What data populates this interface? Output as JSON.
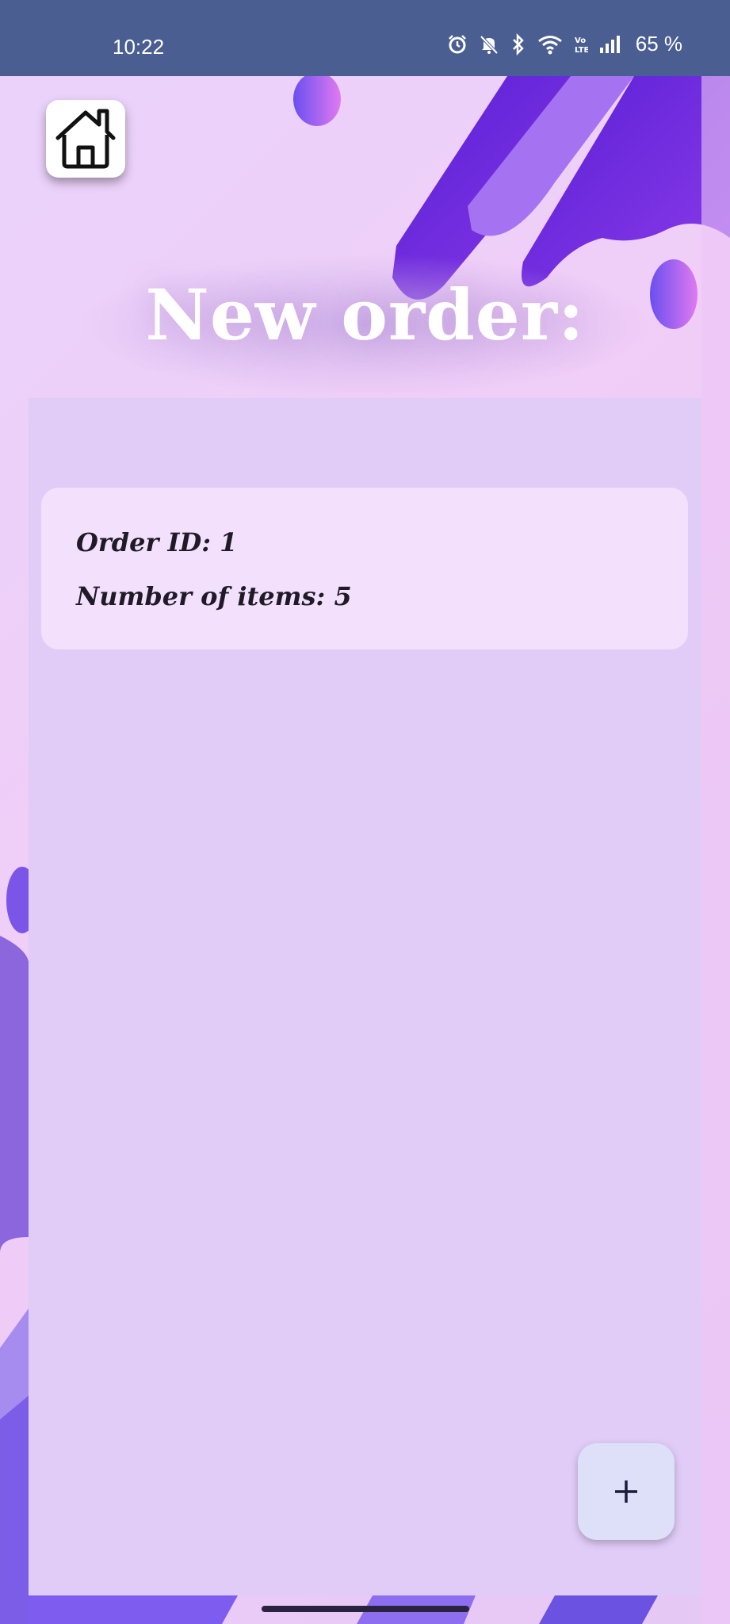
{
  "status_bar": {
    "time": "10:22",
    "battery": "65 %",
    "icons": [
      "alarm-icon",
      "mute-icon",
      "bluetooth-icon",
      "wifi-icon",
      "volte-icon",
      "signal-icon"
    ]
  },
  "header": {
    "home_icon": "home-icon",
    "title": "New order:"
  },
  "orders": [
    {
      "id_label": "Order ID: 1",
      "items_label": "Number of items: 5"
    }
  ],
  "fab": {
    "icon": "plus-icon",
    "symbol": "+"
  },
  "colors": {
    "status_bar": "#4a5e91",
    "panel": "#e1ccf8",
    "card": "#f2e0fd",
    "fab": "#dde0f8",
    "accent_purple": "#7a3fe0"
  }
}
